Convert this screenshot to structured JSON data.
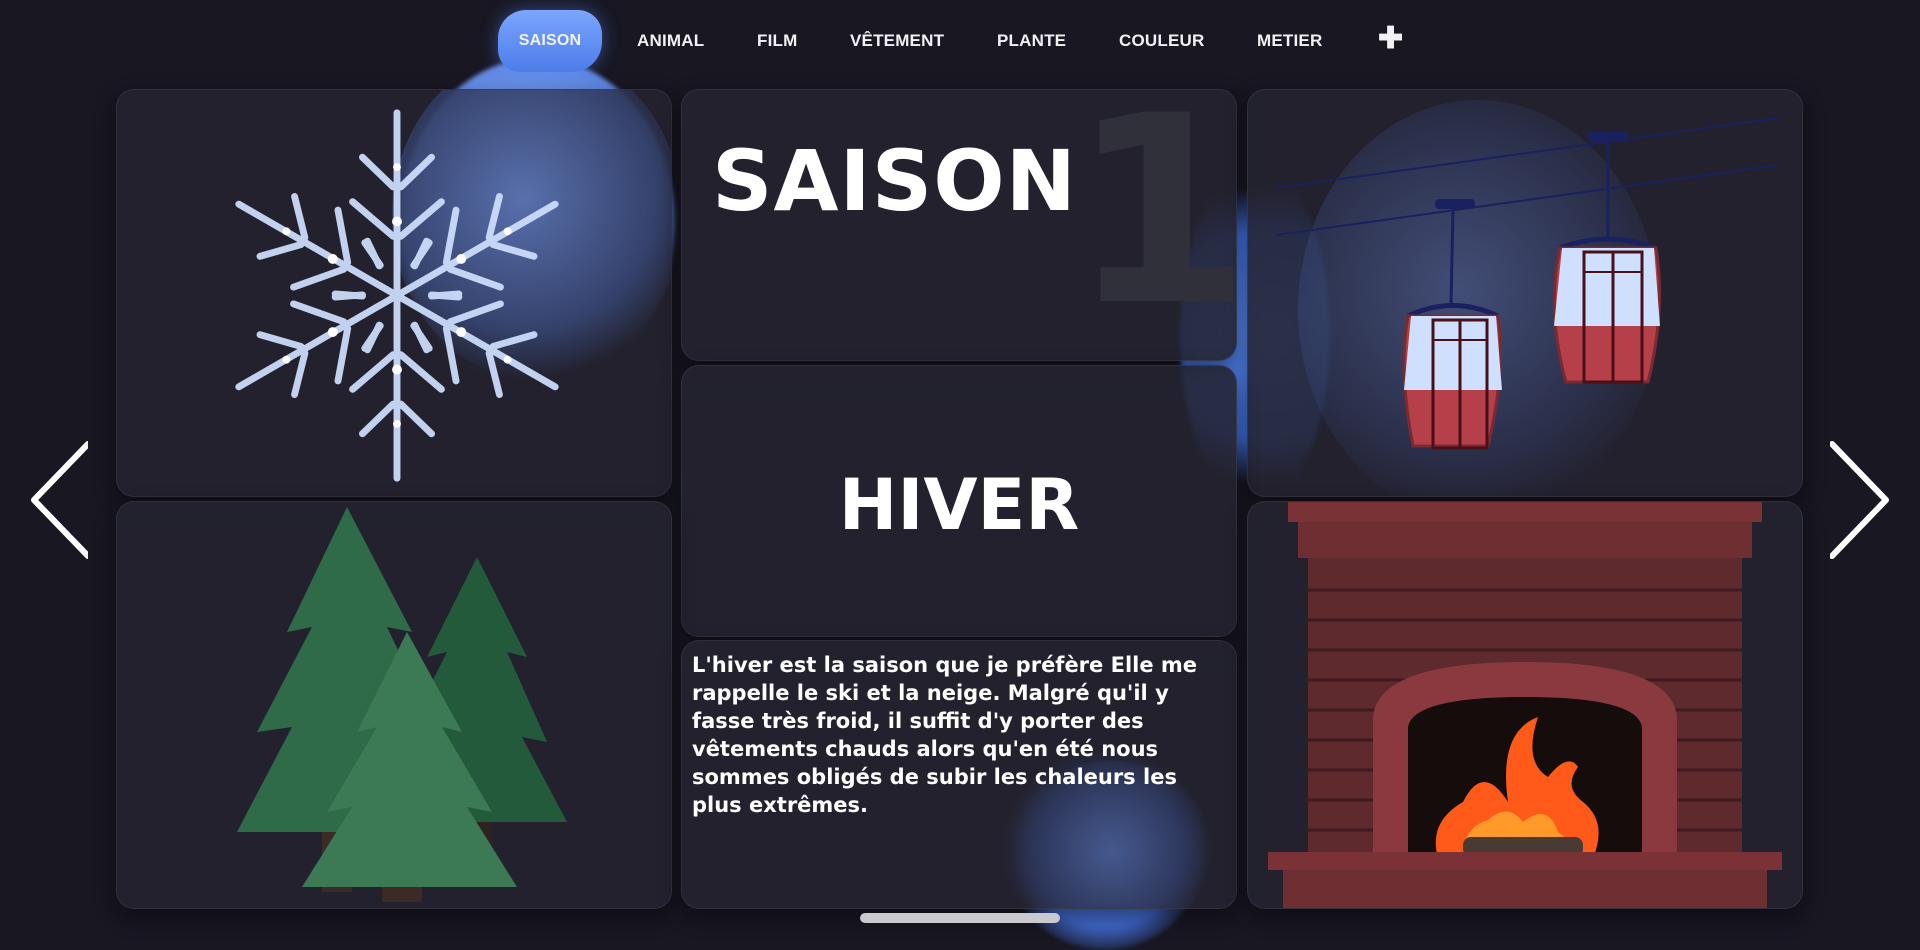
{
  "nav": {
    "items": [
      "SAISON",
      "ANIMAL",
      "FILM",
      "VÊTEMENT",
      "PLANTE",
      "COULEUR",
      "METIER"
    ],
    "active": "SAISON",
    "add_icon": "plus-icon"
  },
  "card": {
    "category": "SAISON",
    "number": "1",
    "title": "HIVER",
    "description": "L'hiver est la saison que je préfère Elle me rappelle le ski et la neige. Malgré qu'il y fasse très froid, il suffit d'y porter des vêtements chauds alors qu'en été nous sommes obligés de subir les chaleurs les plus extrêmes."
  },
  "icons": {
    "prev": "chevron-left-icon",
    "next": "chevron-right-icon",
    "snowflake": "snowflake-icon",
    "trees": "pine-trees-icon",
    "cable_car": "cable-car-icon",
    "fireplace": "fireplace-icon"
  },
  "colors": {
    "background": "#181722",
    "accent": "#5b8cf0",
    "card": "#24232f",
    "cabin_red": "#b5404a",
    "brick": "#6e2f33",
    "flame": "#ff5a1a"
  }
}
